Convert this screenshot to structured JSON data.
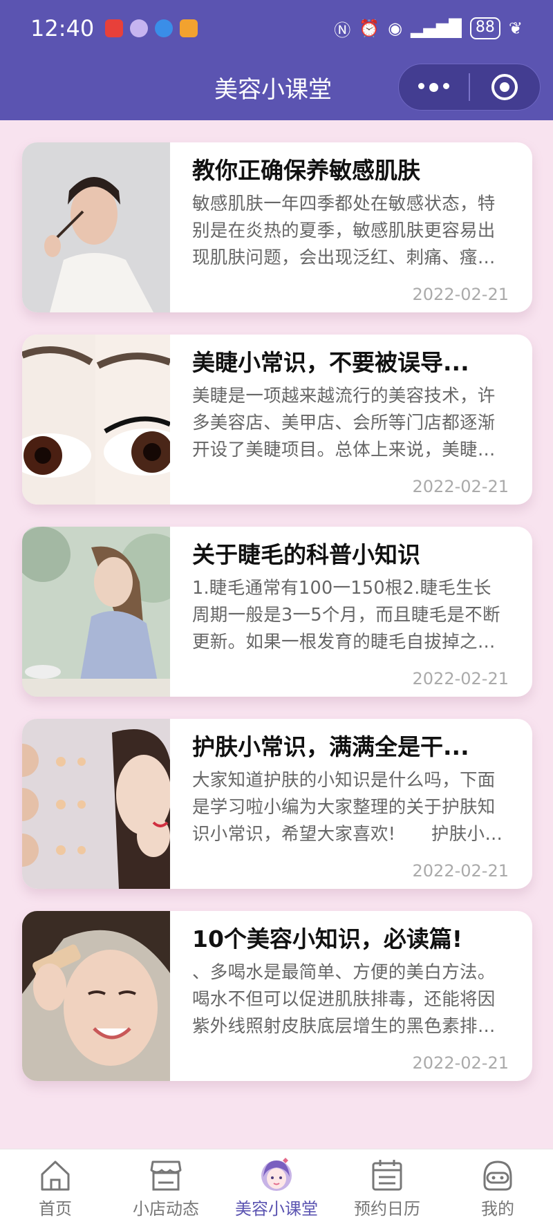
{
  "status_bar": {
    "time": "12:40",
    "battery": "88",
    "notif_colors": [
      "#e8403a",
      "#c6b4f0",
      "#3a8ee8",
      "#f2a22f"
    ]
  },
  "nav": {
    "title": "美容小课堂",
    "more_icon": "more-dots-icon",
    "close_icon": "target-close-icon"
  },
  "articles": [
    {
      "title": "教你正确保养敏感肌肤",
      "summary": "敏感肌肤一年四季都处在敏感状态，特别是在炎热的夏季，敏感肌肤更容易出现肌肤问题，会出现泛红、刺痛、瘙痒等症状。",
      "date": "2022-02-21"
    },
    {
      "title": "美睫小常识，不要被误导...",
      "summary": "美睫是一项越来越流行的美容技术，许多美容店、美甲店、会所等门店都逐渐开设了美睫项目。总体上来说，美睫分为嫁接和种植两种。",
      "date": "2022-02-21"
    },
    {
      "title": "关于睫毛的科普小知识",
      "summary": "1.睫毛通常有100一150根2.睫毛生长周期一般是3一5个月，而且睫毛是不断更新。如果一根发育的睫毛自拔掉之后，大约一周后会长出新的。",
      "date": "2022-02-21"
    },
    {
      "title": "护肤小常识，满满全是干...",
      "summary": "大家知道护肤的小知识是什么吗，下面是学习啦小编为大家整理的关于护肤知识小常识，希望大家喜欢!　　护肤小常识一：选择适合自己的产品。",
      "date": "2022-02-21"
    },
    {
      "title": "10个美容小知识，必读篇!",
      "summary": "、多喝水是最简单、方便的美白方法。喝水不但可以促进肌肤排毒，还能将因紫外线照射皮肤底层增生的黑色素排出体外。",
      "date": "2022-02-21"
    }
  ],
  "tabbar": {
    "active_color": "#5b54b1",
    "items": [
      {
        "label": "首页",
        "icon": "home-icon"
      },
      {
        "label": "小店动态",
        "icon": "shop-icon"
      },
      {
        "label": "美容小课堂",
        "icon": "beauty-girl-icon"
      },
      {
        "label": "预约日历",
        "icon": "calendar-icon"
      },
      {
        "label": "我的",
        "icon": "profile-robot-icon"
      }
    ]
  }
}
